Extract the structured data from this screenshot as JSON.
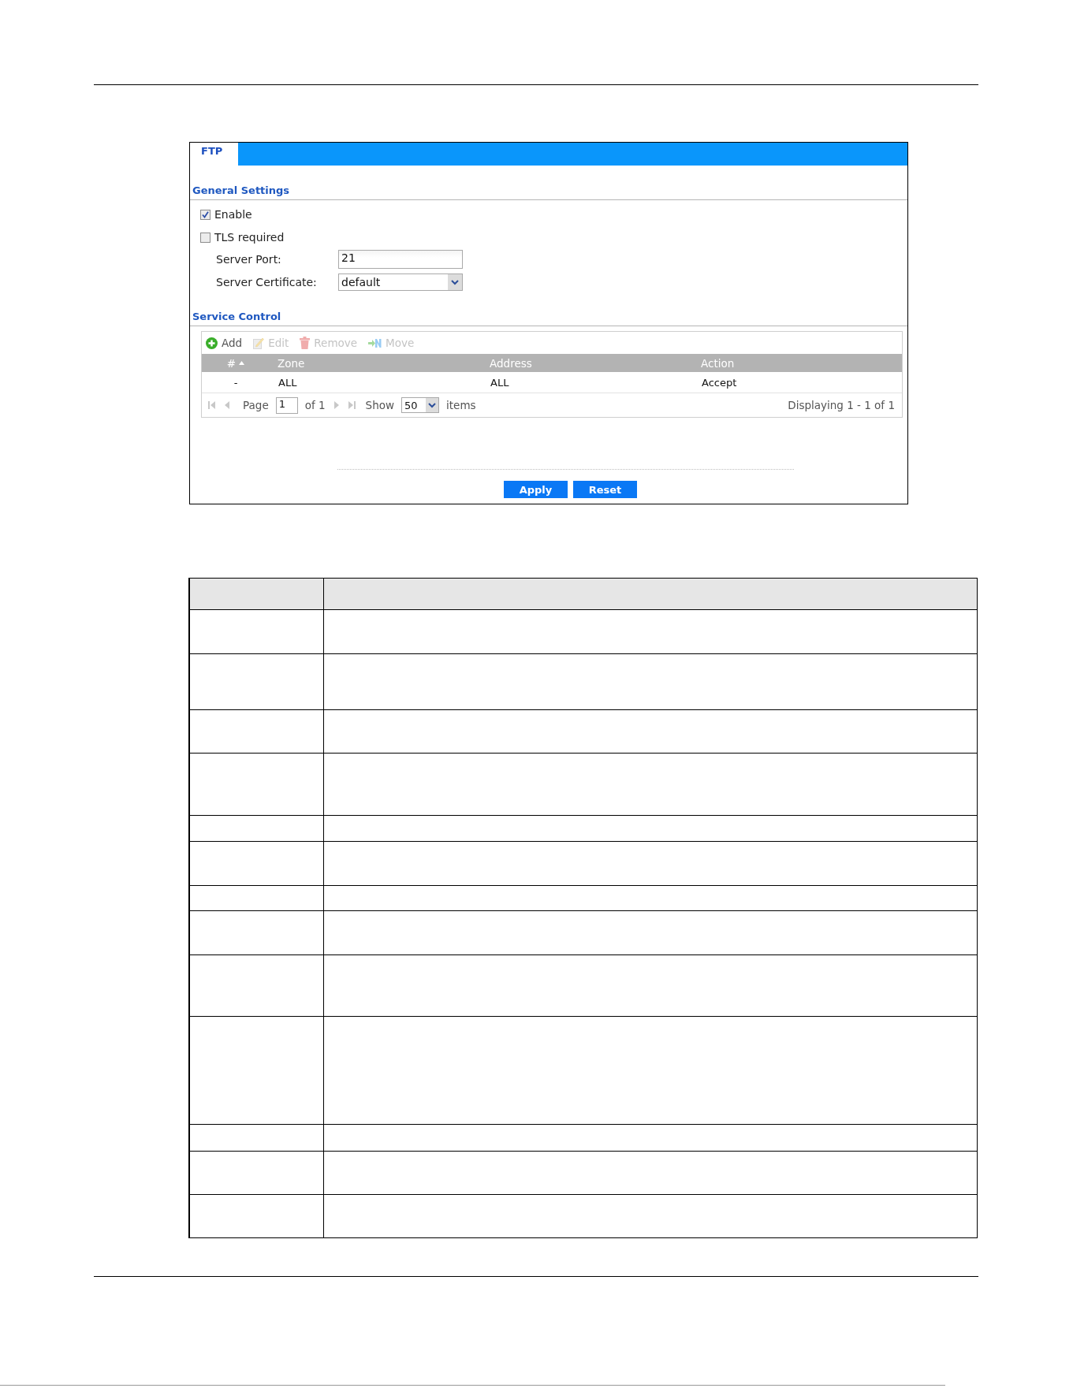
{
  "tab": {
    "label": "FTP",
    "selected": true
  },
  "general_settings": {
    "title": "General Settings",
    "options": [
      {
        "label": "Enable",
        "checked": true
      },
      {
        "label": "TLS required",
        "checked": false
      }
    ],
    "fields": [
      {
        "kind": "text",
        "label": "Server Port:",
        "value": "21"
      },
      {
        "kind": "select",
        "label": "Server Certificate:",
        "value": "default"
      }
    ]
  },
  "service_control": {
    "title": "Service Control",
    "toolbar": [
      {
        "kind": "add",
        "label": "Add",
        "disabled": false
      },
      {
        "kind": "edit",
        "label": "Edit",
        "disabled": true
      },
      {
        "kind": "remove",
        "label": "Remove",
        "disabled": true
      },
      {
        "kind": "move",
        "label": "Move",
        "disabled": true
      }
    ],
    "columns": [
      {
        "label": "#",
        "sorted": true
      },
      {
        "label": "Zone",
        "sorted": false
      },
      {
        "label": "Address",
        "sorted": false
      },
      {
        "label": "Action",
        "sorted": false
      }
    ],
    "rows": [
      [
        "-",
        "ALL",
        "ALL",
        "Accept"
      ]
    ],
    "pager": {
      "page_label": "Page",
      "page": "1",
      "of": "of 1",
      "show_label": "Show",
      "per_page": "50",
      "items_label": "items",
      "summary": "Displaying 1 - 1 of 1"
    }
  },
  "buttons": [
    {
      "label": "Apply"
    },
    {
      "label": "Reset"
    }
  ]
}
